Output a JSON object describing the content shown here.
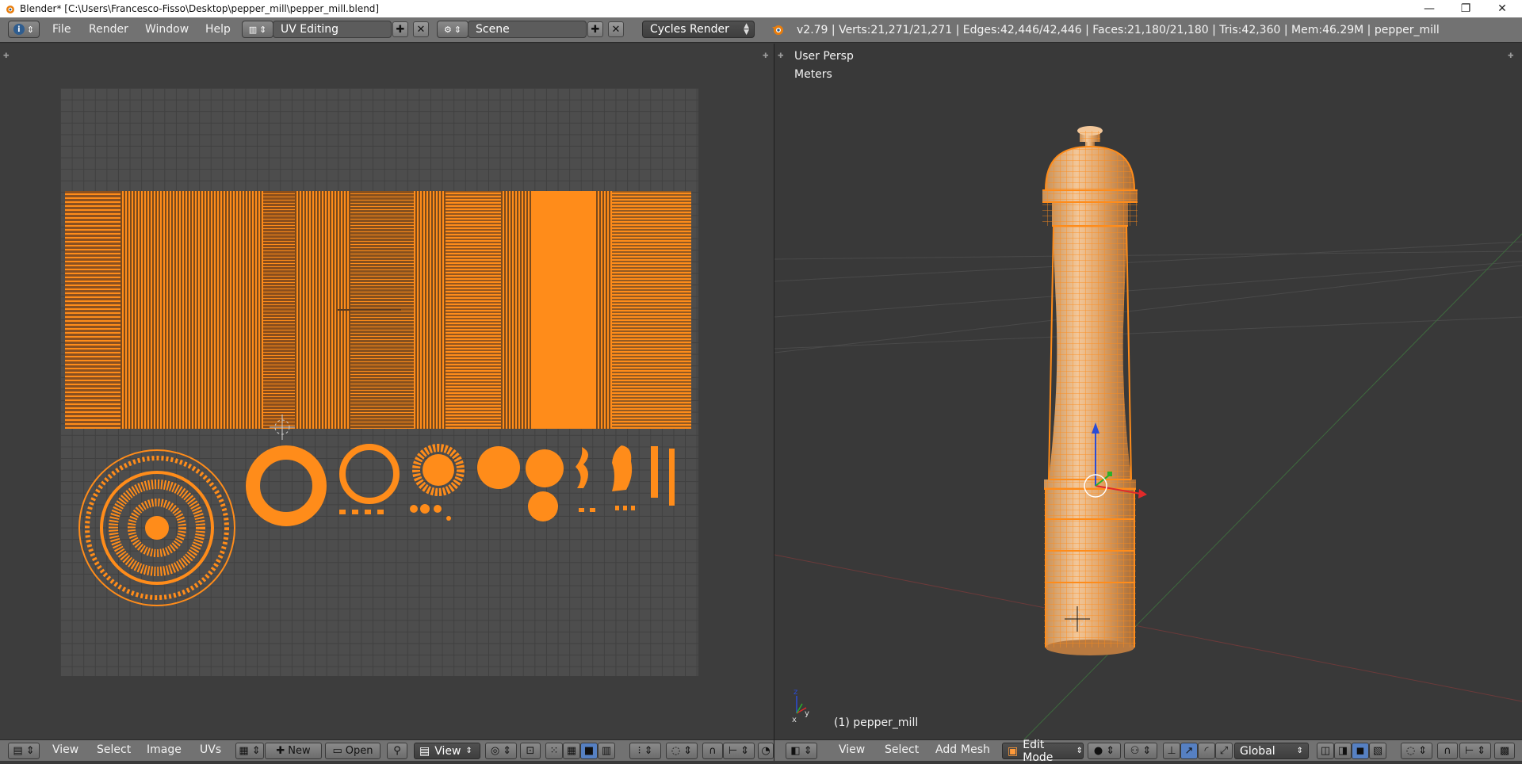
{
  "window": {
    "title": "Blender* [C:\\Users\\Francesco-Fisso\\Desktop\\pepper_mill\\pepper_mill.blend]",
    "controls": {
      "minimize": "—",
      "restore": "❐",
      "close": "✕"
    }
  },
  "info_header": {
    "menus": [
      "File",
      "Render",
      "Window",
      "Help"
    ],
    "screen_layout": "UV Editing",
    "scene": "Scene",
    "render_engine": "Cycles Render",
    "stats": "v2.79 | Verts:21,271/21,271 | Edges:42,446/42,446 | Faces:21,180/21,180 | Tris:42,360 | Mem:46.29M | pepper_mill"
  },
  "uv_editor": {
    "menus": [
      "View",
      "Select",
      "Image",
      "UVs"
    ],
    "new_label": "New",
    "open_label": "Open",
    "view_label": "View"
  },
  "viewport": {
    "view_name": "User Persp",
    "units": "Meters",
    "object_label": "(1) pepper_mill",
    "menus": [
      "View",
      "Select",
      "Add",
      "Mesh"
    ],
    "mode": "Edit Mode",
    "orientation": "Global"
  },
  "colors": {
    "selection_orange": "#ff8c1a",
    "header_gray": "#727272",
    "background": "#393939"
  }
}
